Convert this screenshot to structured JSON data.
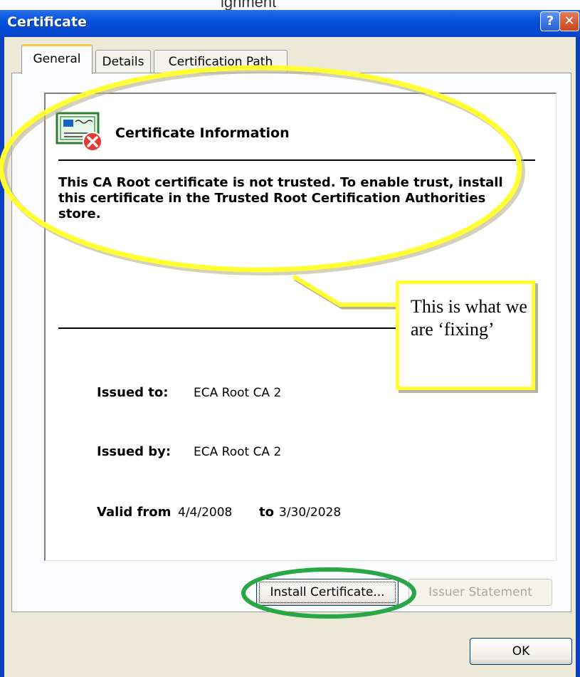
{
  "window": {
    "title": "Certificate",
    "help_button": "?",
    "close_button": "✕",
    "top_crop_text": "ignment"
  },
  "tabs": [
    {
      "label": "General",
      "active": true
    },
    {
      "label": "Details",
      "active": false
    },
    {
      "label": "Certification Path",
      "active": false
    }
  ],
  "info": {
    "heading": "Certificate Information",
    "warning": "This CA Root certificate is not trusted. To enable trust, install this certificate in the Trusted Root Certification Authorities store."
  },
  "fields": {
    "issued_to_label": "Issued to:",
    "issued_to_value": "ECA Root CA 2",
    "issued_by_label": "Issued by:",
    "issued_by_value": "ECA Root CA 2",
    "valid_from_label": "Valid from",
    "valid_from_value": "4/4/2008",
    "valid_to_label": "to",
    "valid_to_value": "3/30/2028"
  },
  "buttons": {
    "install": "Install Certificate...",
    "issuer_statement": "Issuer Statement",
    "ok": "OK"
  },
  "annotations": {
    "callout_text": "This is what we are ‘fixing’",
    "highlight_color": "#ffff33",
    "circle_color": "#28a745"
  }
}
